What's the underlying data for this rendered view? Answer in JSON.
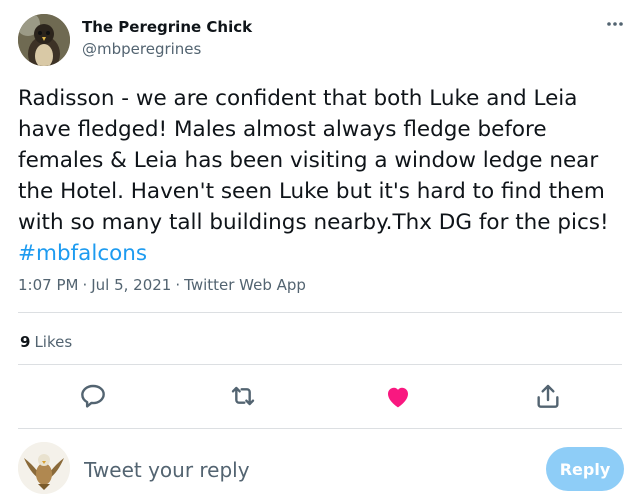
{
  "author": {
    "display_name": "The Peregrine Chick",
    "handle": "@mbperegrines"
  },
  "tweet": {
    "lines": [
      "Radisson - we are confident that both Luke and Leia",
      "have fledged! Males almost always fledge before",
      "females & Leia has been visiting a window ledge near",
      "the Hotel. Haven't seen Luke but it's hard to find them",
      "with so many tall buildings nearby.Thx DG for the pics!"
    ],
    "hashtag": "#mbfalcons"
  },
  "meta": {
    "time": "1:07 PM",
    "separator": "·",
    "date": "Jul 5, 2021",
    "source": "Twitter Web App"
  },
  "stats": {
    "likes_count": "9",
    "likes_label": "Likes"
  },
  "actions": [
    {
      "icon": "reply-icon"
    },
    {
      "icon": "retweet-icon"
    },
    {
      "icon": "heart-icon",
      "active": true,
      "color": "#f91880"
    },
    {
      "icon": "share-icon"
    }
  ],
  "reply_box": {
    "placeholder": "Tweet your reply",
    "button_label": "Reply"
  },
  "colors": {
    "accent": "#1d9bf0",
    "reply_button_disabled": "#8ecdf7",
    "like_active": "#f91880",
    "secondary_text": "#536471"
  }
}
